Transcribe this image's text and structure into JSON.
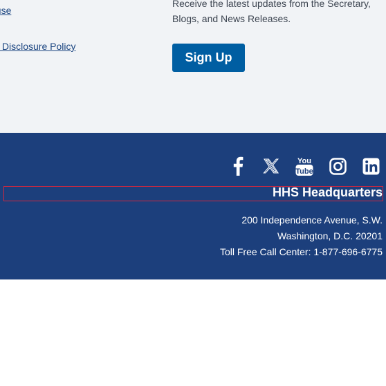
{
  "links": {
    "link1": "ouse",
    "link2": "y Disclosure Policy"
  },
  "signup": {
    "description": "Receive the latest updates from the Secretary, Blogs, and News Releases.",
    "button_label": "Sign Up"
  },
  "social": [
    {
      "icon": "facebook-icon"
    },
    {
      "icon": "x-twitter-icon"
    },
    {
      "icon": "youtube-icon"
    },
    {
      "icon": "instagram-icon"
    },
    {
      "icon": "linkedin-icon"
    }
  ],
  "hq": {
    "title": "HHS Headquarters",
    "line1": "200 Independence Avenue, S.W.",
    "line2": "Washington, D.C. 20201",
    "line3": "Toll Free Call Center: 1-877-696-6775"
  },
  "colors": {
    "band": "#1c3f7c",
    "button": "#005ea2",
    "upper_bg": "#f1f3f6",
    "link": "#1a4480"
  }
}
